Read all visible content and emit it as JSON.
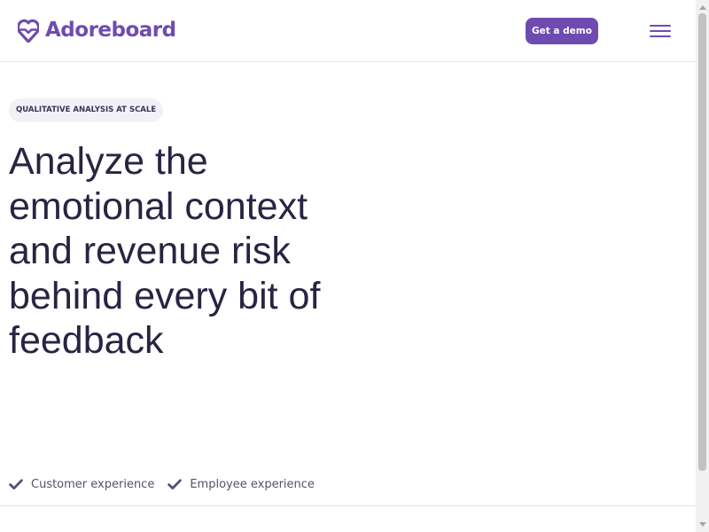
{
  "header": {
    "logo_text": "Adoreboard",
    "logo_icon": "heart-logo-icon",
    "demo_button_label": "Get a demo",
    "menu_icon": "hamburger-menu-icon"
  },
  "hero": {
    "badge": "QUALITATIVE ANALYSIS AT SCALE",
    "headline": "Analyze the emotional context and revenue risk behind every bit of feedback"
  },
  "features": [
    {
      "icon": "check-icon",
      "label": "Customer experience"
    },
    {
      "icon": "check-icon",
      "label": "Employee experience"
    }
  ],
  "colors": {
    "brand": "#6f4bb1",
    "heading": "#2a2442",
    "badge_bg": "#f2f1f8",
    "feature_text": "#55506b"
  }
}
